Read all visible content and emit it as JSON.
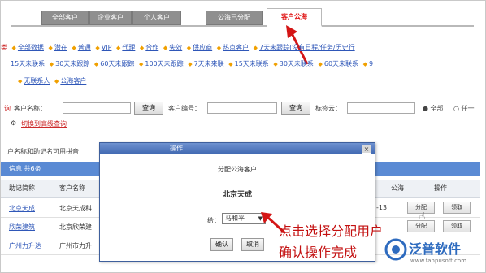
{
  "tabs": [
    "全部客户",
    "企业客户",
    "个人客户",
    "公海已分配",
    "客户公海"
  ],
  "filters": {
    "row1_prefix": "类",
    "row1": [
      "全部数据",
      "潜在",
      "普通",
      "VIP",
      "代理",
      "合作",
      "失效",
      "供应商",
      "热点客户",
      "7天未跟踪(没有日程/任务/历史行"
    ],
    "row2": [
      "15天未联系",
      "30天未跟踪",
      "60天未跟踪",
      "100天未跟踪",
      "7天未来联",
      "15天未联系",
      "30天未联系",
      "60天未联系",
      "9"
    ],
    "row3": [
      "无联系人",
      "公海客户"
    ]
  },
  "search": {
    "prefix": "询",
    "name_label": "客户名称：",
    "query_btn": "查询",
    "code_label": "客户编号：",
    "query_btn2": "查询",
    "tag_label": "标签云：",
    "radio_all": "全部",
    "radio_any": "任一",
    "advanced_link": "切换到高级查询",
    "hint": "户名称和助记名可用拼音"
  },
  "table": {
    "title": "信息 共6条",
    "headers": [
      "助记简称",
      "客户名称",
      "公海",
      "操作"
    ],
    "rows": [
      {
        "short": "北京天成",
        "name": "北京天成科",
        "date": "-13",
        "op1": "分配",
        "op2": "领取"
      },
      {
        "short": "欣荣建筑",
        "name": "北京欣荣建",
        "op1": "分配",
        "op2": "领取"
      },
      {
        "short": "广州力升达",
        "name": "广州市力升"
      }
    ]
  },
  "dialog": {
    "title": "操作",
    "close": "×",
    "heading": "分配公海客户",
    "customer": "北京天成",
    "to_label": "给：",
    "assignee": "马和平",
    "confirm": "确认",
    "cancel": "取消"
  },
  "annotations": {
    "line1": "点击选择分配用户",
    "line2": "确认操作完成"
  },
  "logo": {
    "brand": "泛普软件",
    "url": "www.fanpusoft.com"
  },
  "colors": {
    "accent": "#e01616",
    "header_bar": "#5a8ad4",
    "dialog_title": "#3f67b0",
    "link": "#2f57b8"
  }
}
